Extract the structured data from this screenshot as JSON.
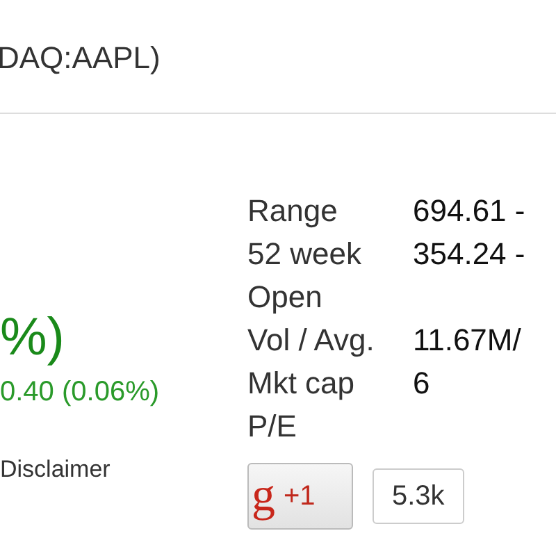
{
  "title": "DAQ:AAPL)",
  "quote": {
    "change_tail": "%)",
    "change": "0.40 (0.06%)",
    "disclaimer": "Disclaimer"
  },
  "stats": [
    {
      "label": "Range",
      "value": "694.61 -"
    },
    {
      "label": "52 week",
      "value": "354.24 -"
    },
    {
      "label": "Open"
    },
    {
      "label": "Vol / Avg.",
      "value": "11.67M/"
    },
    {
      "label": "Mkt cap",
      "value": "6"
    },
    {
      "label": "P/E"
    }
  ],
  "plus_one": {
    "logo_letter": "g",
    "label": "+1",
    "count": "5.3k"
  }
}
